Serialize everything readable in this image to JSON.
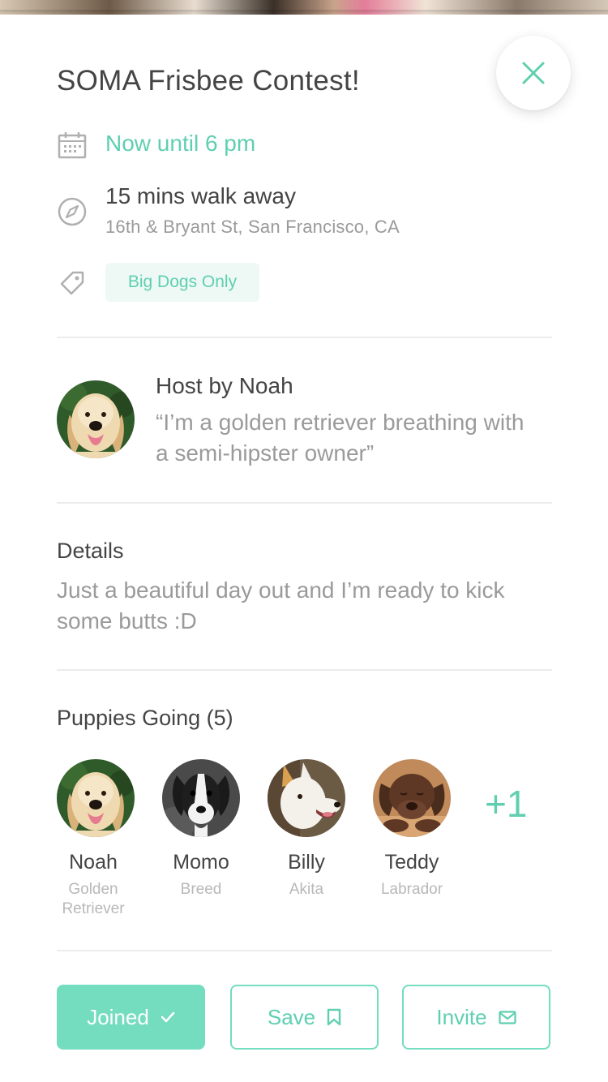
{
  "event": {
    "title": "SOMA Frisbee Contest!",
    "time": "Now until 6 pm",
    "walk": "15 mins walk away",
    "address": "16th & Bryant St, San Francisco, CA",
    "tag": "Big Dogs Only"
  },
  "host": {
    "label": "Host by Noah",
    "quote": "“I’m a golden retriever breathing with a semi-hipster owner”"
  },
  "details": {
    "heading": "Details",
    "body": "Just a beautiful day out and I’m ready to kick some butts :D"
  },
  "going": {
    "heading": "Puppies Going (5)",
    "more": "+1",
    "puppies": [
      {
        "name": "Noah",
        "breed": "Golden Retriever"
      },
      {
        "name": "Momo",
        "breed": "Breed"
      },
      {
        "name": "Billy",
        "breed": "Akita"
      },
      {
        "name": "Teddy",
        "breed": "Labrador"
      }
    ]
  },
  "actions": {
    "joined": "Joined",
    "save": "Save",
    "invite": "Invite"
  },
  "icons": {
    "close": "close-icon",
    "calendar": "calendar-icon",
    "compass": "compass-icon",
    "tag": "tag-icon",
    "check": "check-icon",
    "bookmark": "bookmark-icon",
    "mail": "mail-icon"
  },
  "colors": {
    "accent": "#74dcbf",
    "accent_text": "#5fcfb0",
    "text": "#444444",
    "muted": "#9a9a9a"
  }
}
